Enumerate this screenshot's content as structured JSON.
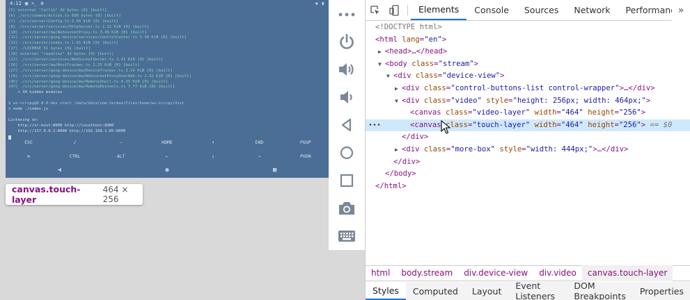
{
  "screen": {
    "status_left": "4:12",
    "terminal_lines": [
      {
        "t": "[5] external \"fallib\" 42 bytes {0} [built]",
        "c": "g"
      },
      {
        "t": "[6] ./src/common/Action.ts 608 bytes {0} [built]",
        "c": "g"
      },
      {
        "t": "[7] ./src/server/Config.ts 2.56 KiB {0} [built]",
        "c": "g"
      },
      {
        "t": "[8] ./src/server/services/HttpServer.ts 2.32 KiB {0} [built]",
        "c": "g"
      },
      {
        "t": "[10] ./src/server/mw/WebsocketProxy.ts 3.49 KiB {0} [built]",
        "c": "g"
      },
      {
        "t": "[11] ./src/server/goog-device/services/ControlCenter.ts 5.38 KiB {0} [built]",
        "c": "g"
      },
      {
        "t": "[12] ./src/server/index.ts 1.61 KiB {0} [built]",
        "c": "g"
      },
      {
        "t": "[17] ./LICENSE 51 bytes {0} [built]",
        "c": "g"
      },
      {
        "t": "[18] external \"readline\" 42 bytes {0} [built]",
        "c": "g"
      },
      {
        "t": "[22] ./src/server/services/WebSocketServer.ts 3.41 KiB {0} [built]",
        "c": "g"
      },
      {
        "t": "[26] ./src/server/mw/HostTracker.ts 2.25 KiB {0} [built]",
        "c": "g"
      },
      {
        "t": "[27] ./src/server/goog-device/mw/DeviceTracker.ts 3.29 KiB {0} [built]",
        "c": "g"
      },
      {
        "t": "[28] ./src/server/goog-device/mw/WebsocketProxyOverAdb.ts 2.92 KiB {0} [built]",
        "c": "g"
      },
      {
        "t": "[45] ./src/server/goog-device/mw/RemoteShell.ts 4.25 KiB {0} [built]",
        "c": "g"
      },
      {
        "t": "[47] ./src/server/goog-device/mw/RemoteDevtools.ts 7.77 KiB {0} [built]",
        "c": "g"
      },
      {
        "t": "    + 34 hidden modules",
        "c": "w"
      },
      {
        "t": "",
        "c": "w"
      },
      {
        "t": "$ ws-scrcpy@0.8.0-dev start /data/data/com.termux/files/home/ws-scrcpy/dist",
        "c": "c"
      },
      {
        "t": "> node ./index.js",
        "c": "w"
      },
      {
        "t": "",
        "c": "w"
      },
      {
        "t": "Listening on:",
        "c": "w"
      },
      {
        "t": "    http://xr-host:8000 http://localhost:8000",
        "c": "w"
      },
      {
        "t": "    http://127.0.0.1:8000 http://192.168.1.85:8000",
        "c": "w"
      }
    ],
    "keys_row1": [
      "ESC",
      "/",
      "—",
      "HOME",
      "↑",
      "END",
      "PGUP"
    ],
    "keys_row2": [
      "⇆",
      "CTRL",
      "ALT",
      "←",
      "↓",
      "→",
      "PGDN"
    ],
    "nav": [
      "◀",
      "●",
      "■"
    ]
  },
  "tooltip": {
    "selector": "canvas.touch-layer",
    "size": "464 × 256"
  },
  "devtools": {
    "tabs": [
      "Elements",
      "Console",
      "Sources",
      "Network",
      "Performance"
    ],
    "more": "»",
    "tree": {
      "doctype": "<!DOCTYPE html>",
      "html_open": "<html",
      "html_attr": "lang",
      "html_val": "\"en\"",
      "head": "<head>…</head>",
      "body_tag": "<body",
      "body_attr": "class",
      "body_val": "\"stream\"",
      "dv_tag": "<div",
      "dv_val": "\"device-view\"",
      "ctrl_val": "\"control-buttons-list control-wrapper\"",
      "ctrl_end": "…</div>",
      "video_val": "\"video\"",
      "video_style_attr": "style",
      "video_style_val": "\"height: 256px; width: 464px;\"",
      "canvas_tag": "<canvas",
      "vl_val": "\"video-layer\"",
      "w_attr": "width",
      "w_val": "\"464\"",
      "h_attr": "height",
      "h_val": "\"256\"",
      "tl_val": "\"touch-layer\"",
      "sel_marker": "== $0",
      "div_close": "</div>",
      "more_val": "\"more-box\"",
      "more_style_val": "\"width: 444px;\"",
      "more_end": "…</div>",
      "body_close": "</body>",
      "html_close": "</html>"
    },
    "breadcrumbs": [
      "html",
      "body.stream",
      "div.device-view",
      "div.video",
      "canvas.touch-layer"
    ],
    "subtabs": [
      "Styles",
      "Computed",
      "Layout",
      "Event Listeners",
      "DOM Breakpoints",
      "Properties"
    ]
  },
  "colors": {
    "screen_bg": "#4a6e96",
    "accent": "#1a73e8",
    "tag": "#881280",
    "attr": "#994500",
    "value": "#1a1aa6"
  }
}
